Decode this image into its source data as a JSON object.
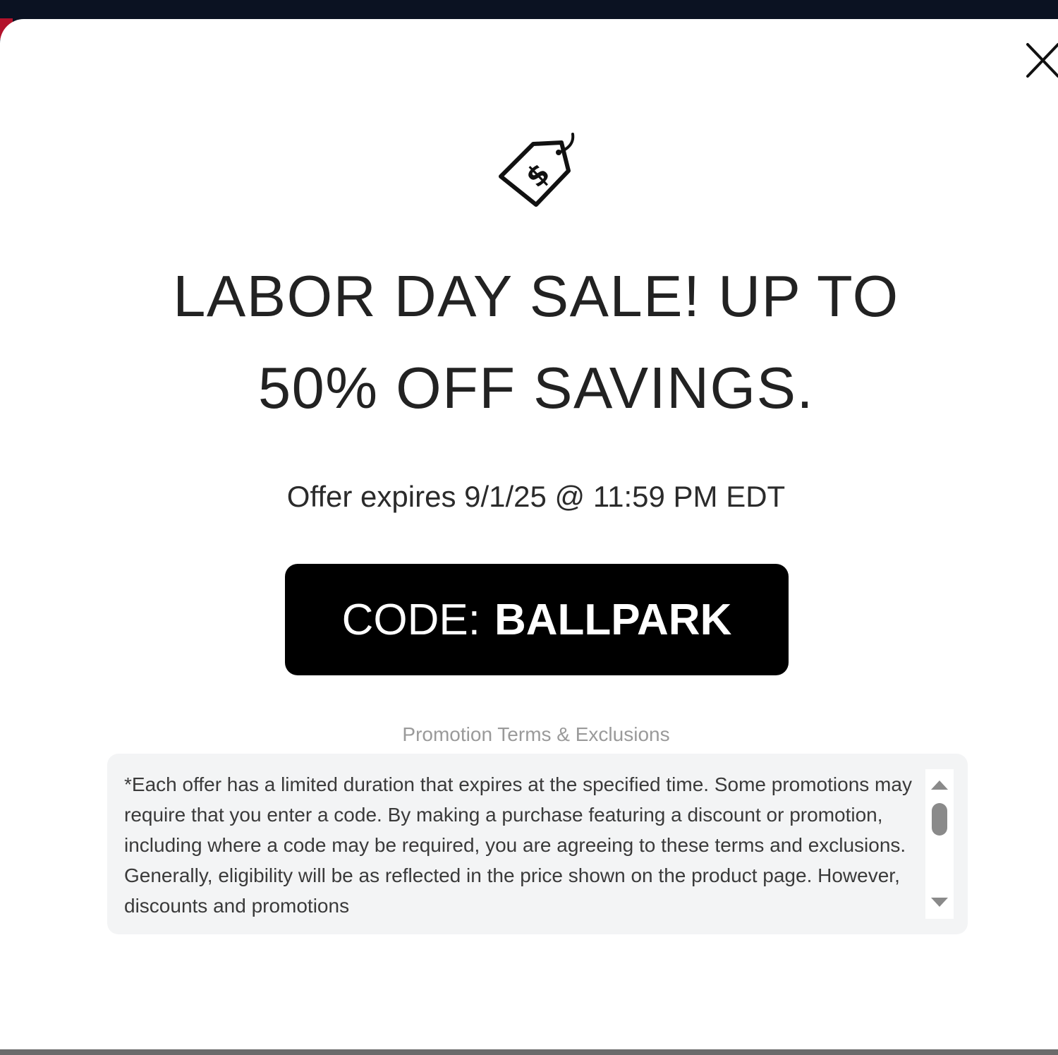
{
  "modal": {
    "close_icon": "close-icon",
    "tag_icon": "price-tag-dollar-icon",
    "headline_line1": "LABOR DAY SALE! UP TO",
    "headline_line2": "50% OFF SAVINGS.",
    "expiry": "Offer expires 9/1/25 @ 11:59 PM EDT",
    "code_prefix": "CODE:",
    "code_value": "BALLPARK",
    "terms_title": "Promotion Terms & Exclusions",
    "terms_text": "*Each offer has a limited duration that expires at the specified time. Some promotions may require that you enter a code. By making a purchase featuring a discount or promotion, including where a code may be required, you are agreeing to these terms and exclusions. Generally, eligibility will be as reflected in the price shown on the product page. However, discounts and promotions"
  },
  "colors": {
    "page_background": "#0b1222",
    "modal_background": "#ffffff",
    "code_button_background": "#000000",
    "code_button_text": "#ffffff",
    "terms_background": "#f3f4f5",
    "accent": "#b3122b"
  }
}
